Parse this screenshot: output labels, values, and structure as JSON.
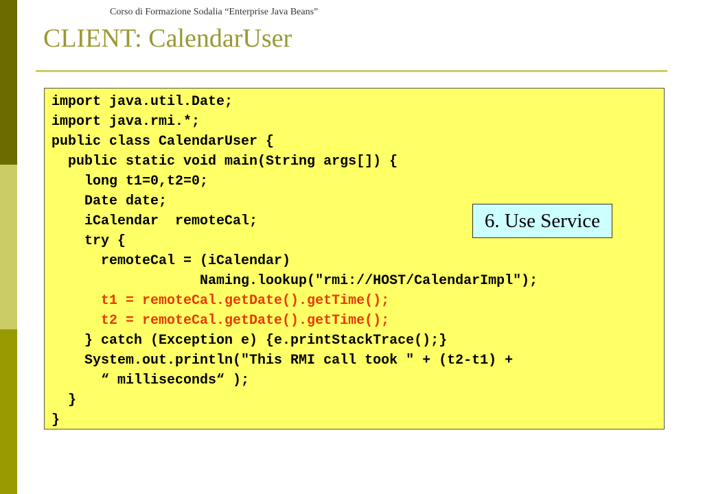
{
  "header": {
    "course_note": "Corso di Formazione Sodalia “Enterprise Java Beans”"
  },
  "slide": {
    "title": "CLIENT: CalendarUser"
  },
  "code": {
    "lines": [
      "import java.util.Date;",
      "import java.rmi.*;",
      "public class CalendarUser {",
      "  public static void main(String args[]) {",
      "    long t1=0,t2=0;",
      "    Date date;",
      "    iCalendar  remoteCal;",
      "    try {",
      "      remoteCal = (iCalendar)",
      "                  Naming.lookup(\"rmi://HOST/CalendarImpl\");",
      "      t1 = remoteCal.getDate().getTime();",
      "      t2 = remoteCal.getDate().getTime();",
      "    } catch (Exception e) {e.printStackTrace();}",
      "    System.out.println(\"This RMI call took \" + (t2-t1) +",
      "      “ milliseconds“ );",
      "  }",
      "}"
    ],
    "highlight_color": "#e83a00",
    "background_color": "#ffff66"
  },
  "callout": {
    "label": "6. Use Service",
    "background_color": "#ccffff"
  },
  "theme": {
    "title_color": "#999933",
    "sidebar_colors": [
      "#6b6b00",
      "#cccc66",
      "#999900"
    ]
  }
}
